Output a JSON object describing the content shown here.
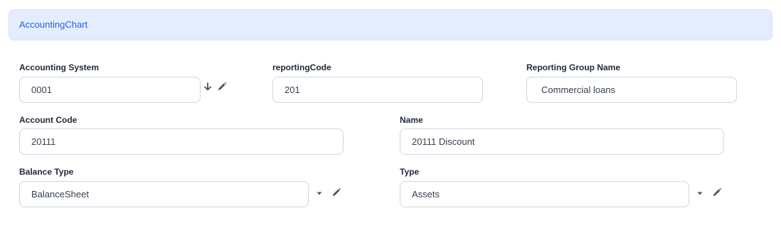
{
  "header": {
    "title": "AccountingChart"
  },
  "fields": {
    "accounting_system": {
      "label": "Accounting System",
      "value": "0001"
    },
    "reporting_code": {
      "label": "reportingCode",
      "value": "201"
    },
    "reporting_group_name": {
      "label": "Reporting Group Name",
      "value": "Commercial loans"
    },
    "account_code": {
      "label": "Account Code",
      "value": "20111"
    },
    "name": {
      "label": "Name",
      "value": "20111 Discount"
    },
    "balance_type": {
      "label": "Balance Type",
      "value": "BalanceSheet"
    },
    "type": {
      "label": "Type",
      "value": "Assets"
    }
  },
  "icons": {
    "arrow": "arrow-down-icon",
    "edit": "pencil-icon",
    "dropdown": "caret-down-icon"
  },
  "colors": {
    "header_bg": "#e3edfc",
    "header_text": "#2563eb",
    "icon": "#4b5563"
  }
}
